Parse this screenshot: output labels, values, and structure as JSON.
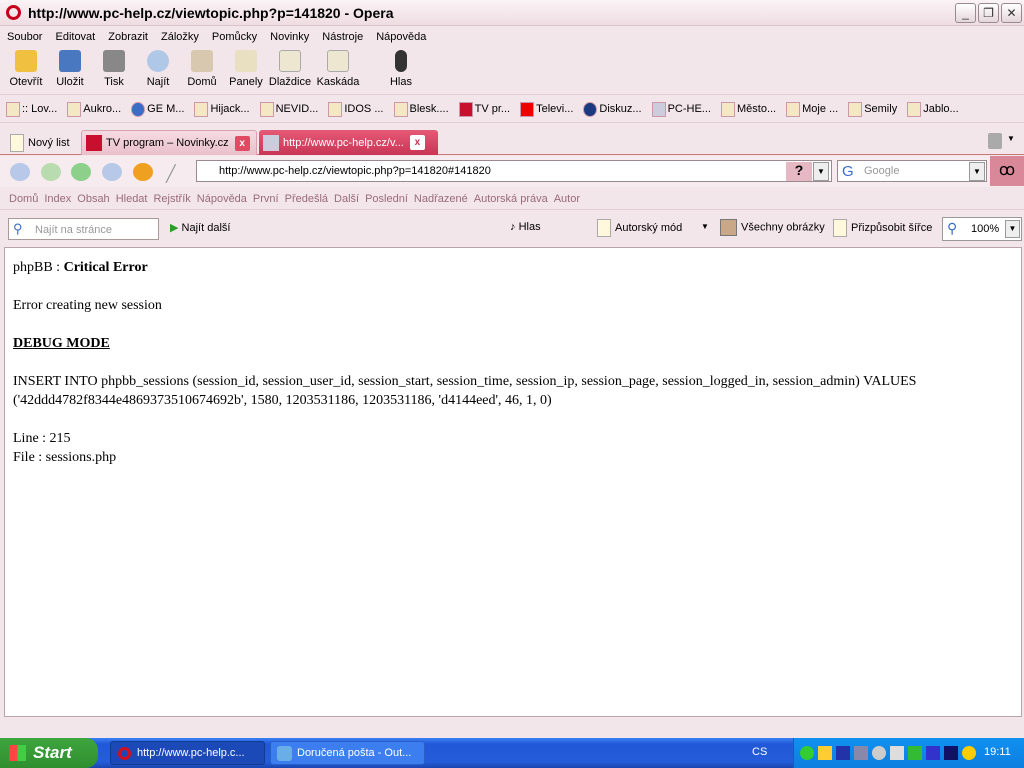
{
  "window": {
    "title": "http://www.pc-help.cz/viewtopic.php?p=141820 - Opera"
  },
  "menu": [
    "Soubor",
    "Editovat",
    "Zobrazit",
    "Záložky",
    "Pomůcky",
    "Novinky",
    "Nástroje",
    "Nápověda"
  ],
  "toolbar": [
    {
      "label": "Otevřít",
      "icon": "folder-icon"
    },
    {
      "label": "Uložit",
      "icon": "save-icon"
    },
    {
      "label": "Tisk",
      "icon": "print-icon"
    },
    {
      "label": "Najít",
      "icon": "search-icon"
    },
    {
      "label": "Domů",
      "icon": "home-icon"
    },
    {
      "label": "Panely",
      "icon": "panels-icon"
    },
    {
      "label": "Dlaždice",
      "icon": "tile-icon"
    },
    {
      "label": "Kaskáda",
      "icon": "cascade-icon"
    },
    {
      "label": "Hlas",
      "icon": "voice-icon"
    }
  ],
  "bookmarks": [
    ":: Lov...",
    "Aukro...",
    "GE M...",
    "Hijack...",
    "NEVID...",
    "IDOS ...",
    "Blesk....",
    "TV pr...",
    "Televi...",
    "Diskuz...",
    "PC-HE...",
    "Město...",
    "Moje ...",
    "Semily",
    "Jablo..."
  ],
  "tabs": {
    "new_tab": "Nový list",
    "items": [
      {
        "label": "TV program – Novinky.cz"
      },
      {
        "label": "http://www.pc-help.cz/v...",
        "active": true
      }
    ]
  },
  "address": {
    "url": "http://www.pc-help.cz/viewtopic.php?p=141820#141820",
    "search_placeholder": "Google"
  },
  "nav_links": [
    "Domů",
    "Index",
    "Obsah",
    "Hledat",
    "Rejstřík",
    "Nápověda",
    "První",
    "Předešlá",
    "Další",
    "Poslední",
    "Nadřazené",
    "Autorská práva",
    "Autor"
  ],
  "findbar": {
    "placeholder": "Najít na stránce",
    "find_next": "Najít další",
    "voice": "Hlas",
    "author_mode": "Autorský mód",
    "all_images": "Všechny obrázky",
    "fit_width": "Přizpůsobit šířce",
    "zoom": "100%"
  },
  "content": {
    "header_prefix": "phpBB : ",
    "header_bold": "Critical Error",
    "message": "Error creating new session",
    "debug": "DEBUG MODE",
    "sql": "INSERT INTO phpbb_sessions (session_id, session_user_id, session_start, session_time, session_ip, session_page, session_logged_in, session_admin) VALUES ('42ddd4782f8344e4869373510674692b', 1580, 1203531186, 1203531186, 'd4144eed', 46, 1, 0)",
    "line": "Line : 215",
    "file": "File : sessions.php"
  },
  "taskbar": {
    "start": "Start",
    "tasks": [
      "http://www.pc-help.c...",
      "Doručená pošta - Out..."
    ],
    "lang": "CS",
    "clock": "19:11"
  }
}
